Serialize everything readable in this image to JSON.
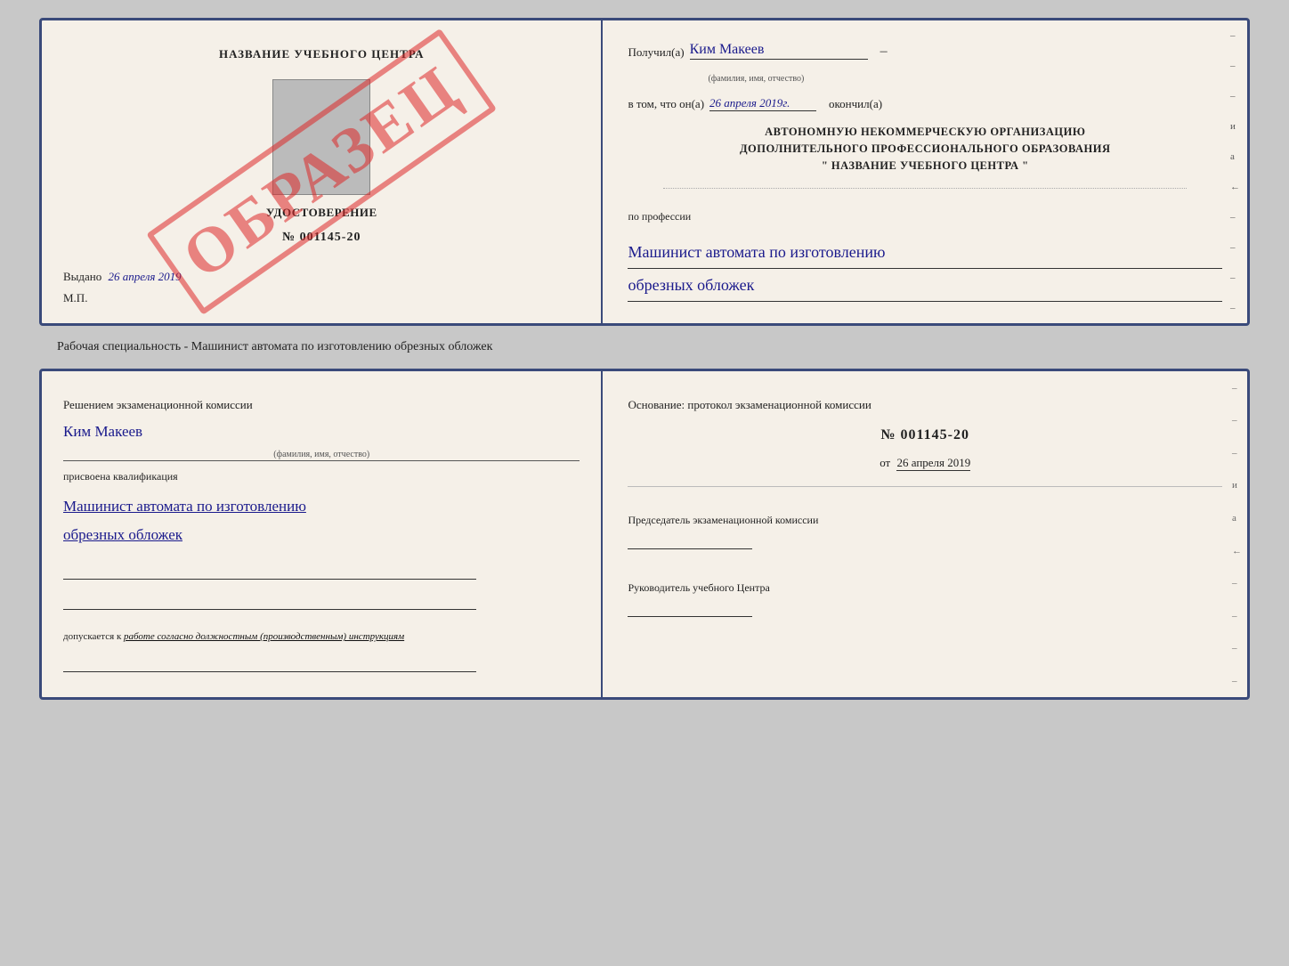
{
  "top_doc": {
    "left": {
      "school_name": "НАЗВАНИЕ УЧЕБНОГО ЦЕНТРА",
      "cert_label": "УДОСТОВЕРЕНИЕ",
      "cert_number": "№ 001145-20",
      "vydano_label": "Выдано",
      "vydano_date": "26 апреля 2019",
      "mp_label": "М.П.",
      "obrazets": "ОБРАЗЕЦ"
    },
    "right": {
      "poluchil_label": "Получил(а)",
      "poluchil_name": "Ким Макеев",
      "fio_hint": "(фамилия, имя, отчество)",
      "vtom_label": "в том, что он(а)",
      "date_value": "26 апреля 2019г.",
      "okonchil_label": "окончил(а)",
      "org_line1": "АВТОНОМНУЮ НЕКОММЕРЧЕСКУЮ ОРГАНИЗАЦИЮ",
      "org_line2": "ДОПОЛНИТЕЛЬНОГО ПРОФЕССИОНАЛЬНОГО ОБРАЗОВАНИЯ",
      "org_line3": "\"  НАЗВАНИЕ УЧЕБНОГО ЦЕНТРА  \"",
      "po_professii_label": "по профессии",
      "profession_line1": "Машинист автомата по изготовлению",
      "profession_line2": "обрезных обложек"
    }
  },
  "caption": {
    "text": "Рабочая специальность - Машинист автомата по изготовлению обрезных обложек"
  },
  "bottom_doc": {
    "left": {
      "resheniem_text": "Решением экзаменационной комиссии",
      "name": "Ким Макеев",
      "fio_hint": "(фамилия, имя, отчество)",
      "prisvoena_text": "присвоена квалификация",
      "qualification_line1": "Машинист автомата по изготовлению",
      "qualification_line2": "обрезных обложек",
      "dopuskaetsya_prefix": "допускается к",
      "dopuskaetsya_text": "работе согласно должностным (производственным) инструкциям"
    },
    "right": {
      "osnovanie_label": "Основание: протокол экзаменационной комиссии",
      "protocol_number": "№ 001145-20",
      "ot_prefix": "от",
      "ot_date": "26 апреля 2019",
      "chairman_label": "Председатель экзаменационной комиссии",
      "rukovoditel_label": "Руководитель учебного Центра"
    }
  },
  "dashes": [
    "-",
    "-",
    "-",
    "и",
    "а",
    "←",
    "-",
    "-",
    "-",
    "-"
  ]
}
